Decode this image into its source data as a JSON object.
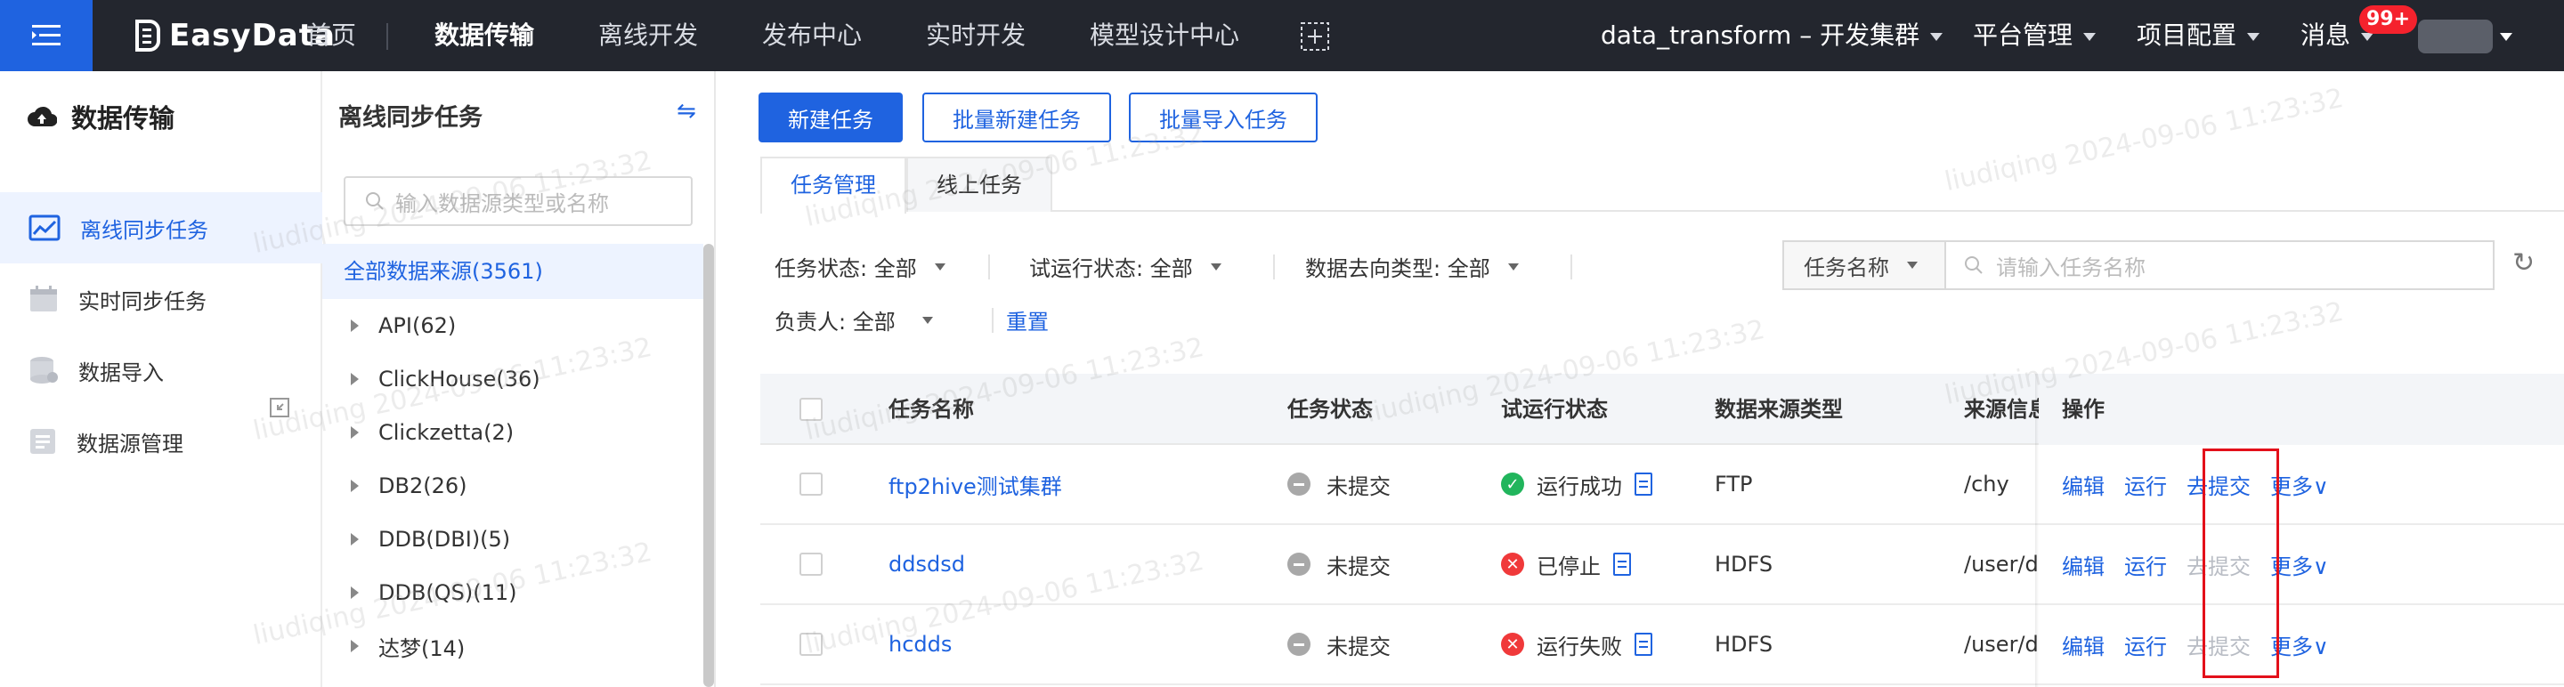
{
  "topbar": {
    "brand": "EasyData",
    "nav": [
      "首页",
      "数据传输",
      "离线开发",
      "发布中心",
      "实时开发",
      "模型设计中心"
    ],
    "cluster": "data_transform – 开发集群",
    "platform": "平台管理",
    "project": "项目配置",
    "messages": "消息",
    "badge": "99+"
  },
  "sidebar": {
    "title": "数据传输",
    "items": [
      {
        "label": "离线同步任务",
        "icon": "chart-icon",
        "active": true
      },
      {
        "label": "实时同步任务",
        "icon": "calendar-icon",
        "active": false
      },
      {
        "label": "数据导入",
        "icon": "database-icon",
        "active": false
      },
      {
        "label": "数据源管理",
        "icon": "document-icon",
        "active": false
      }
    ]
  },
  "tree": {
    "title": "离线同步任务",
    "search_placeholder": "输入数据源类型或名称",
    "all": "全部数据来源(3561)",
    "nodes": [
      "API(62)",
      "ClickHouse(36)",
      "Clickzetta(2)",
      "DB2(26)",
      "DDB(DBI)(5)",
      "DDB(QS)(11)",
      "达梦(14)"
    ]
  },
  "actions": {
    "new_task": "新建任务",
    "batch_new": "批量新建任务",
    "batch_import": "批量导入任务"
  },
  "tabs": [
    "任务管理",
    "线上任务"
  ],
  "filters": {
    "task_status": "任务状态: 全部",
    "trial_status": "试运行状态: 全部",
    "dest_type": "数据去向类型: 全部",
    "owner": "负责人: 全部",
    "reset": "重置",
    "search_by": "任务名称",
    "search_placeholder": "请输入任务名称"
  },
  "table": {
    "headers": [
      "任务名称",
      "任务状态",
      "试运行状态",
      "数据来源类型",
      "来源信息",
      "操作"
    ],
    "rows": [
      {
        "name": "ftp2hive测试集群",
        "status": "未提交",
        "trial": "运行成功",
        "trial_kind": "success",
        "src_type": "FTP",
        "src_info": "/chy",
        "ops": [
          "编辑",
          "运行",
          "去提交",
          "更多"
        ],
        "submit_enabled": true
      },
      {
        "name": "ddsdsd",
        "status": "未提交",
        "trial": "已停止",
        "trial_kind": "stopped",
        "src_type": "HDFS",
        "src_info": "/user/data_transform/h",
        "ops": [
          "编辑",
          "运行",
          "去提交",
          "更多"
        ],
        "submit_enabled": false
      },
      {
        "name": "hcdds",
        "status": "未提交",
        "trial": "运行失败",
        "trial_kind": "failed",
        "src_type": "HDFS",
        "src_info": "/user/data_transform/h",
        "ops": [
          "编辑",
          "运行",
          "去提交",
          "更多"
        ],
        "submit_enabled": false
      }
    ]
  },
  "watermark": "liudiqing 2024-09-06 11:23:32",
  "colors": {
    "primary": "#1f63e0",
    "topbar": "#23262e",
    "highlight": "#e3101a"
  }
}
